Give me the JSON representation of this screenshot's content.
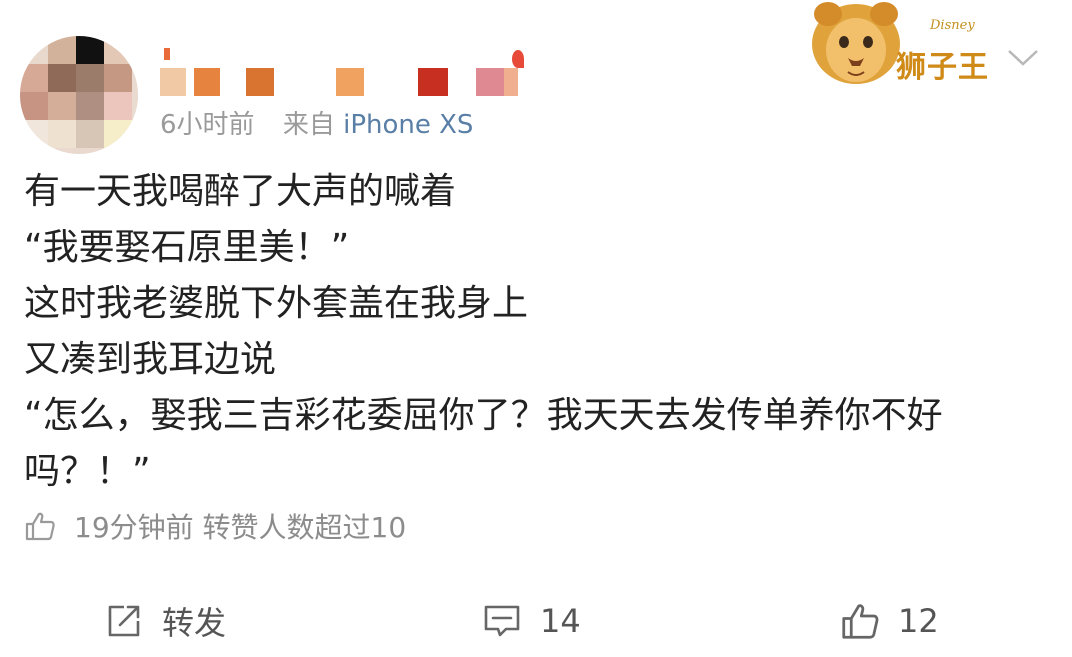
{
  "post_meta": {
    "time": "6小时前",
    "source_prefix": "来自",
    "source_device": "iPhone XS"
  },
  "badge": {
    "title": "狮子王",
    "brand": "Disney",
    "icon": "lion-icon"
  },
  "post_body": {
    "lines": [
      "有一天我喝醉了大声的喊着",
      "“我要娶石原里美！”",
      "这时我老婆脱下外套盖在我身上",
      "又凑到我耳边说",
      "“怎么，娶我三吉彩花委屈你了？我天天去发传单养你不好",
      "吗？！”"
    ]
  },
  "liked_by": {
    "icon": "thumbs-up-icon",
    "text": "19分钟前 转赞人数超过10"
  },
  "actions": {
    "forward": {
      "icon": "share-icon",
      "label": "转发"
    },
    "comment": {
      "icon": "comment-icon",
      "count": "14"
    },
    "like": {
      "icon": "thumbs-up-icon",
      "count": "12"
    }
  },
  "colors": {
    "text": "#222222",
    "meta": "#9a9a9a",
    "source": "#5a7fa6",
    "badge_gold": "#d08a18"
  }
}
